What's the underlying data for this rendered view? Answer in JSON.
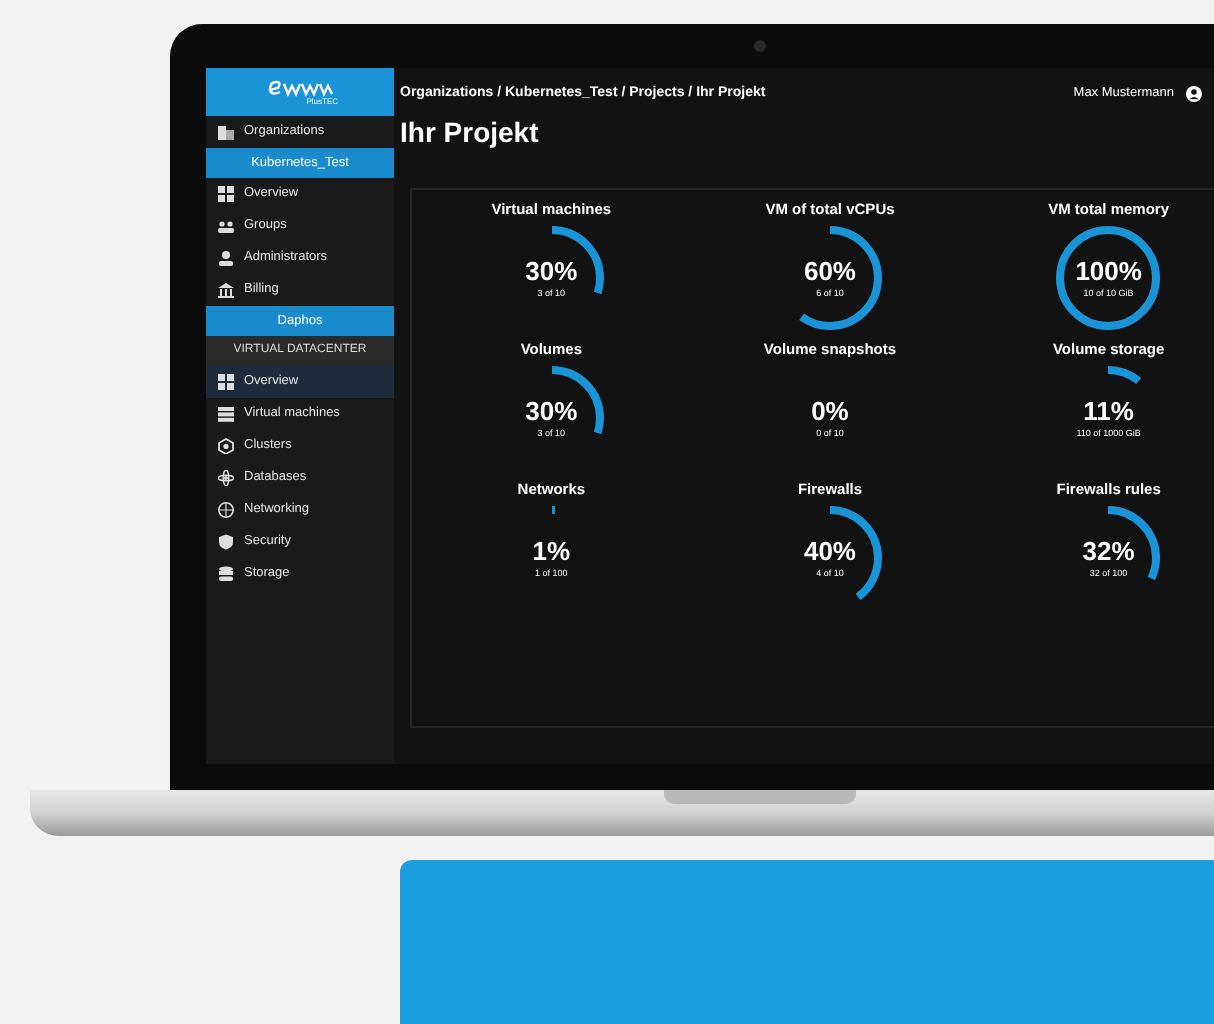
{
  "logo": {
    "subtitle": "PlusTEC"
  },
  "sidebar": {
    "items": [
      {
        "kind": "link",
        "label": "Organizations",
        "selected": false
      },
      {
        "kind": "header",
        "label": "Kubernetes_Test"
      },
      {
        "kind": "link",
        "label": "Overview",
        "selected": false
      },
      {
        "kind": "link",
        "label": "Groups",
        "selected": false
      },
      {
        "kind": "link",
        "label": "Administrators",
        "selected": false
      },
      {
        "kind": "link",
        "label": "Billing",
        "selected": false
      },
      {
        "kind": "header",
        "label": "Daphos"
      },
      {
        "kind": "section",
        "label": "VIRTUAL DATACENTER"
      },
      {
        "kind": "link",
        "label": "Overview",
        "selected": true
      },
      {
        "kind": "link",
        "label": "Virtual machines",
        "selected": false
      },
      {
        "kind": "link",
        "label": "Clusters",
        "selected": false
      },
      {
        "kind": "link",
        "label": "Databases",
        "selected": false
      },
      {
        "kind": "link",
        "label": "Networking",
        "selected": false
      },
      {
        "kind": "link",
        "label": "Security",
        "selected": false
      },
      {
        "kind": "link",
        "label": "Storage",
        "selected": false
      }
    ]
  },
  "breadcrumb": "Organizations / Kubernetes_Test / Projects / Ihr Projekt",
  "user": "Max Mustermann",
  "title": "Ihr Projekt",
  "gauges": [
    {
      "title": "Virtual machines",
      "percent": "30%",
      "detail": "3 of 10",
      "level": 0.3
    },
    {
      "title": "VM of total vCPUs",
      "percent": "60%",
      "detail": "6 of 10",
      "level": 0.6
    },
    {
      "title": "VM total memory",
      "percent": "100%",
      "detail": "10 of 10 GiB",
      "level": 1
    },
    {
      "title": "Volumes",
      "percent": "30%",
      "detail": "3 of 10",
      "level": 0.3
    },
    {
      "title": "Volume snapshots",
      "percent": "0%",
      "detail": "0 of 10"
    },
    {
      "title": "Volume storage",
      "percent": "11%",
      "detail": "110 of 1000 GiB",
      "level": 0.11
    },
    {
      "title": "Networks",
      "percent": "1%",
      "detail": "1 of 100",
      "level": 0.01
    },
    {
      "title": "Firewalls",
      "percent": "40%",
      "detail": "4 of 10",
      "level": 0.4
    },
    {
      "title": "Firewalls rules",
      "percent": "32%",
      "detail": "32 of 100",
      "level": 0.32
    }
  ]
}
